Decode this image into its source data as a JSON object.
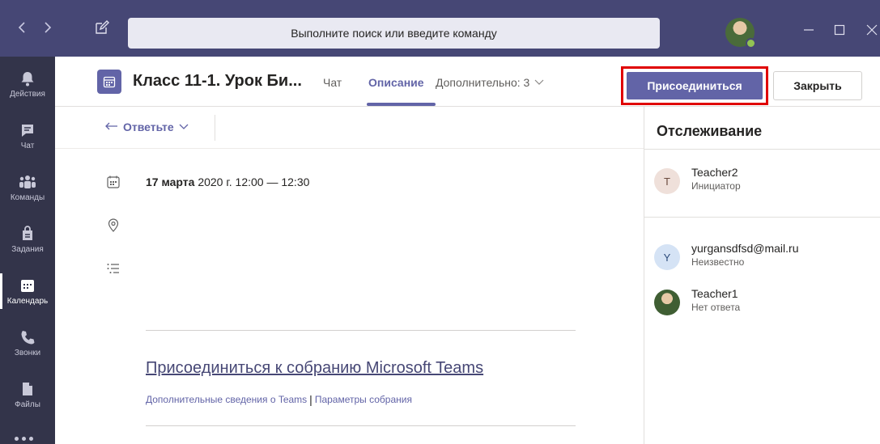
{
  "titlebar": {
    "search_placeholder": "Выполните поиск или введите команду"
  },
  "rail": {
    "items": [
      {
        "label": "Действия",
        "icon": "bell-icon"
      },
      {
        "label": "Чат",
        "icon": "chat-icon"
      },
      {
        "label": "Команды",
        "icon": "teams-icon"
      },
      {
        "label": "Задания",
        "icon": "assignments-icon"
      },
      {
        "label": "Календарь",
        "icon": "calendar-icon"
      },
      {
        "label": "Звонки",
        "icon": "phone-icon"
      },
      {
        "label": "Файлы",
        "icon": "file-icon"
      }
    ],
    "active": "Календарь"
  },
  "header": {
    "title": "Класс 11-1. Урок Би...",
    "tabs": {
      "chat": "Чат",
      "description": "Описание",
      "more": "Дополнительно: 3"
    },
    "join_label": "Присоединиться",
    "close_label": "Закрыть"
  },
  "toolbar": {
    "reply_label": "Ответьте"
  },
  "details": {
    "date_strong": "17 марта",
    "date_rest": " 2020 г. 12:00 — 12:30",
    "join_link": "Присоединиться к собранию Microsoft Teams",
    "more_info_link": "Дополнительные сведения о Teams",
    "separator": "|",
    "meeting_options_link": "Параметры собрания"
  },
  "tracking": {
    "title": "Отслеживание",
    "organizer": {
      "initial": "T",
      "name": "Teacher2",
      "status": "Инициатор"
    },
    "attendees": [
      {
        "initial": "Y",
        "name": "yurgansdfsd@mail.ru",
        "status": "Неизвестно"
      },
      {
        "initial": "",
        "name": "Teacher1",
        "status": "Нет ответа"
      }
    ]
  },
  "colors": {
    "titlebar": "#464775",
    "rail": "#33344a",
    "accent": "#6264a7",
    "highlight": "#e00000"
  }
}
